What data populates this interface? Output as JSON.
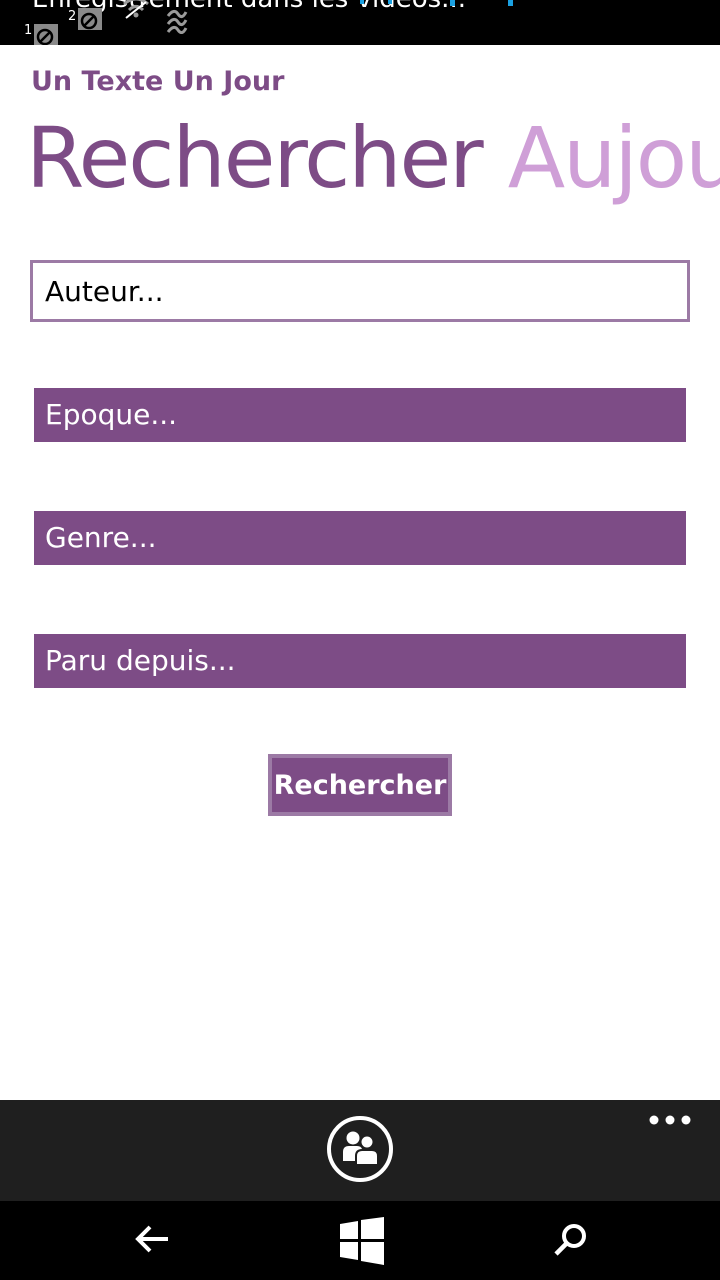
{
  "status_bar": {
    "notification_text": "Enregistrement dans les vidéos..."
  },
  "header": {
    "app_title": "Un Texte Un Jour",
    "pivot": {
      "active": "Rechercher",
      "next": "Aujourd'hui"
    }
  },
  "form": {
    "author_placeholder": "Auteur...",
    "epoch_label": "Epoque...",
    "genre_label": "Genre...",
    "published_since_label": "Paru depuis...",
    "search_button_label": "Rechercher"
  },
  "app_bar": {
    "primary_icon": "people-icon",
    "more_icon": "more-ellipsis-icon"
  },
  "nav_bar": {
    "back_icon": "back-arrow-icon",
    "home_icon": "windows-logo-icon",
    "search_icon": "search-icon"
  },
  "colors": {
    "accent": "#7d4c86",
    "accent_light": "#cf9fd7",
    "input_border": "#9c7aa5",
    "app_bar_bg": "#1f1f1f",
    "system_bar_bg": "#000000",
    "status_dot_blue": "#1ba1e2"
  }
}
